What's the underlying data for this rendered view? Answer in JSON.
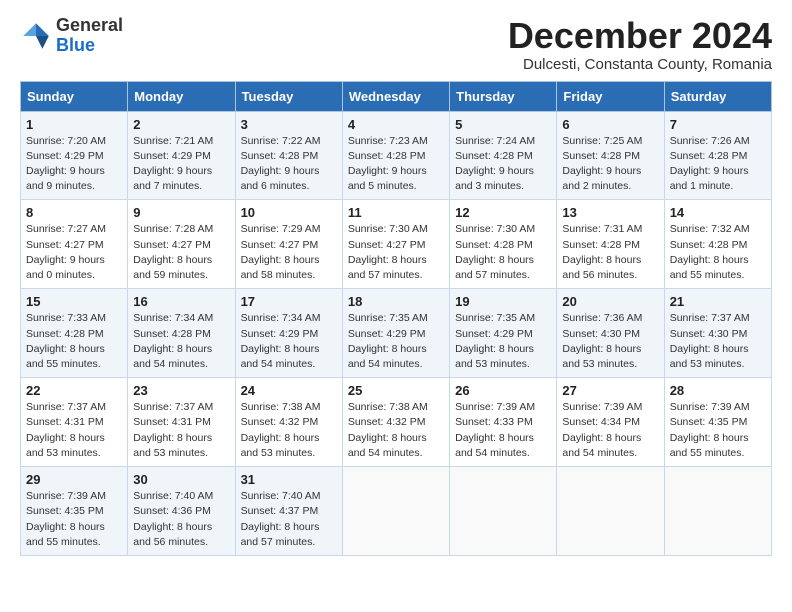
{
  "header": {
    "logo_general": "General",
    "logo_blue": "Blue",
    "month_title": "December 2024",
    "subtitle": "Dulcesti, Constanta County, Romania"
  },
  "weekdays": [
    "Sunday",
    "Monday",
    "Tuesday",
    "Wednesday",
    "Thursday",
    "Friday",
    "Saturday"
  ],
  "weeks": [
    [
      {
        "day": "1",
        "info": "Sunrise: 7:20 AM\nSunset: 4:29 PM\nDaylight: 9 hours\nand 9 minutes."
      },
      {
        "day": "2",
        "info": "Sunrise: 7:21 AM\nSunset: 4:29 PM\nDaylight: 9 hours\nand 7 minutes."
      },
      {
        "day": "3",
        "info": "Sunrise: 7:22 AM\nSunset: 4:28 PM\nDaylight: 9 hours\nand 6 minutes."
      },
      {
        "day": "4",
        "info": "Sunrise: 7:23 AM\nSunset: 4:28 PM\nDaylight: 9 hours\nand 5 minutes."
      },
      {
        "day": "5",
        "info": "Sunrise: 7:24 AM\nSunset: 4:28 PM\nDaylight: 9 hours\nand 3 minutes."
      },
      {
        "day": "6",
        "info": "Sunrise: 7:25 AM\nSunset: 4:28 PM\nDaylight: 9 hours\nand 2 minutes."
      },
      {
        "day": "7",
        "info": "Sunrise: 7:26 AM\nSunset: 4:28 PM\nDaylight: 9 hours\nand 1 minute."
      }
    ],
    [
      {
        "day": "8",
        "info": "Sunrise: 7:27 AM\nSunset: 4:27 PM\nDaylight: 9 hours\nand 0 minutes."
      },
      {
        "day": "9",
        "info": "Sunrise: 7:28 AM\nSunset: 4:27 PM\nDaylight: 8 hours\nand 59 minutes."
      },
      {
        "day": "10",
        "info": "Sunrise: 7:29 AM\nSunset: 4:27 PM\nDaylight: 8 hours\nand 58 minutes."
      },
      {
        "day": "11",
        "info": "Sunrise: 7:30 AM\nSunset: 4:27 PM\nDaylight: 8 hours\nand 57 minutes."
      },
      {
        "day": "12",
        "info": "Sunrise: 7:30 AM\nSunset: 4:28 PM\nDaylight: 8 hours\nand 57 minutes."
      },
      {
        "day": "13",
        "info": "Sunrise: 7:31 AM\nSunset: 4:28 PM\nDaylight: 8 hours\nand 56 minutes."
      },
      {
        "day": "14",
        "info": "Sunrise: 7:32 AM\nSunset: 4:28 PM\nDaylight: 8 hours\nand 55 minutes."
      }
    ],
    [
      {
        "day": "15",
        "info": "Sunrise: 7:33 AM\nSunset: 4:28 PM\nDaylight: 8 hours\nand 55 minutes."
      },
      {
        "day": "16",
        "info": "Sunrise: 7:34 AM\nSunset: 4:28 PM\nDaylight: 8 hours\nand 54 minutes."
      },
      {
        "day": "17",
        "info": "Sunrise: 7:34 AM\nSunset: 4:29 PM\nDaylight: 8 hours\nand 54 minutes."
      },
      {
        "day": "18",
        "info": "Sunrise: 7:35 AM\nSunset: 4:29 PM\nDaylight: 8 hours\nand 54 minutes."
      },
      {
        "day": "19",
        "info": "Sunrise: 7:35 AM\nSunset: 4:29 PM\nDaylight: 8 hours\nand 53 minutes."
      },
      {
        "day": "20",
        "info": "Sunrise: 7:36 AM\nSunset: 4:30 PM\nDaylight: 8 hours\nand 53 minutes."
      },
      {
        "day": "21",
        "info": "Sunrise: 7:37 AM\nSunset: 4:30 PM\nDaylight: 8 hours\nand 53 minutes."
      }
    ],
    [
      {
        "day": "22",
        "info": "Sunrise: 7:37 AM\nSunset: 4:31 PM\nDaylight: 8 hours\nand 53 minutes."
      },
      {
        "day": "23",
        "info": "Sunrise: 7:37 AM\nSunset: 4:31 PM\nDaylight: 8 hours\nand 53 minutes."
      },
      {
        "day": "24",
        "info": "Sunrise: 7:38 AM\nSunset: 4:32 PM\nDaylight: 8 hours\nand 53 minutes."
      },
      {
        "day": "25",
        "info": "Sunrise: 7:38 AM\nSunset: 4:32 PM\nDaylight: 8 hours\nand 54 minutes."
      },
      {
        "day": "26",
        "info": "Sunrise: 7:39 AM\nSunset: 4:33 PM\nDaylight: 8 hours\nand 54 minutes."
      },
      {
        "day": "27",
        "info": "Sunrise: 7:39 AM\nSunset: 4:34 PM\nDaylight: 8 hours\nand 54 minutes."
      },
      {
        "day": "28",
        "info": "Sunrise: 7:39 AM\nSunset: 4:35 PM\nDaylight: 8 hours\nand 55 minutes."
      }
    ],
    [
      {
        "day": "29",
        "info": "Sunrise: 7:39 AM\nSunset: 4:35 PM\nDaylight: 8 hours\nand 55 minutes."
      },
      {
        "day": "30",
        "info": "Sunrise: 7:40 AM\nSunset: 4:36 PM\nDaylight: 8 hours\nand 56 minutes."
      },
      {
        "day": "31",
        "info": "Sunrise: 7:40 AM\nSunset: 4:37 PM\nDaylight: 8 hours\nand 57 minutes."
      },
      {
        "day": "",
        "info": ""
      },
      {
        "day": "",
        "info": ""
      },
      {
        "day": "",
        "info": ""
      },
      {
        "day": "",
        "info": ""
      }
    ]
  ]
}
